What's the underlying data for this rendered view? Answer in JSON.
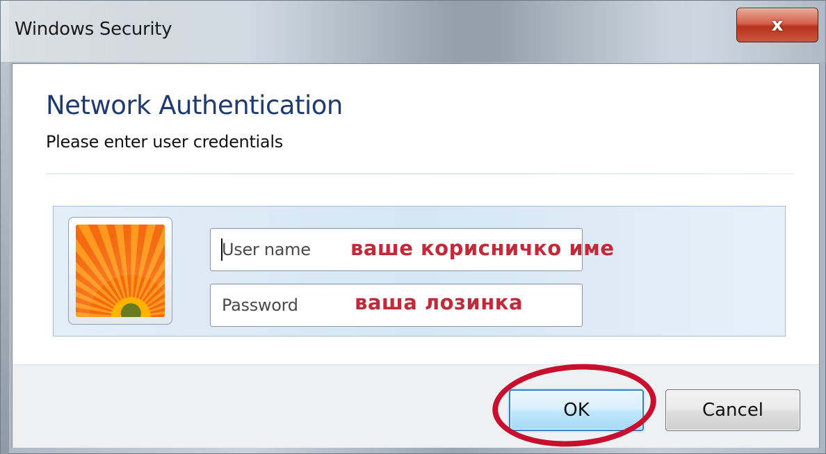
{
  "window": {
    "title": "Windows Security",
    "close_glyph": "x"
  },
  "dialog": {
    "heading": "Network Authentication",
    "subheading": "Please enter user credentials"
  },
  "credentials": {
    "username": {
      "placeholder": "User name",
      "value": "",
      "hint": "ваше корисничко име"
    },
    "password": {
      "placeholder": "Password",
      "value": "",
      "hint": "ваша лозинка"
    },
    "user_tile_icon": "user-picture-orange-flower"
  },
  "buttons": {
    "ok_label": "OK",
    "cancel_label": "Cancel"
  },
  "colors": {
    "heading": "#1e3a6e",
    "hint_text": "#c22a3a",
    "annotation_ring": "#c8102e",
    "ok_border": "#3c7fb1",
    "close_button": "#c9563e"
  }
}
